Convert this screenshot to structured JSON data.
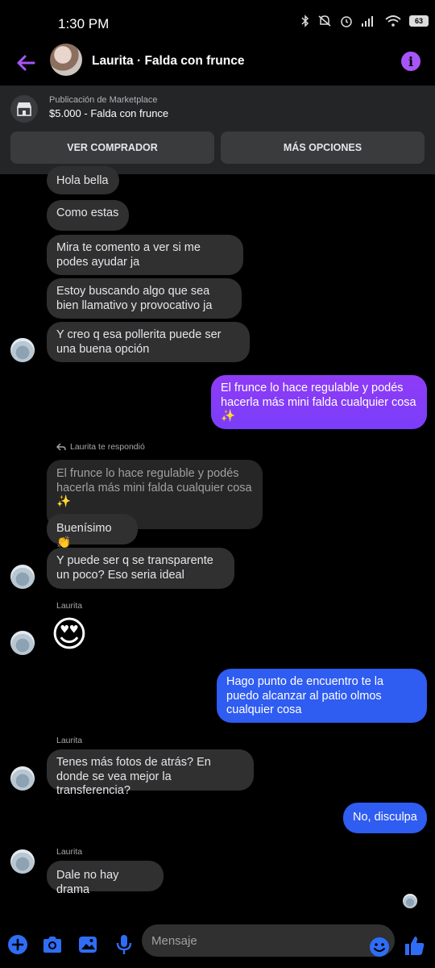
{
  "status_bar": {
    "time": "1:30 PM",
    "battery": "63"
  },
  "header": {
    "title": "Laurita · Falda con frunce"
  },
  "marketplace": {
    "label": "Publicación de Marketplace",
    "item": "$5.000 - Falda con frunce",
    "btn_buyer": "VER COMPRADOR",
    "btn_more": "MÁS OPCIONES"
  },
  "messages": {
    "m1": "Hola bella",
    "m2": "Como estas",
    "m3": "Mira te comento a ver si me podes ayudar ja",
    "m4": "Estoy buscando algo que sea bien llamativo y provocativo ja",
    "m5": "Y creo q esa pollerita puede ser una buena opción",
    "m6": "El frunce lo hace regulable y podés hacerla más mini falda cualquier cosa ✨",
    "reply_label": "Laurita te respondió",
    "quoted": "El frunce lo hace regulable y podés hacerla más mini falda cualquier cosa ✨",
    "m7": "Buenísimo 👏",
    "m8": "Y puede ser q se transparente un poco? Eso seria ideal",
    "name1": "Laurita",
    "m9": "😍",
    "m10": "Hago punto de encuentro te la puedo alcanzar al patio olmos cualquier cosa",
    "name2": "Laurita",
    "m11": "Tenes más fotos de atrás? En donde se vea mejor la transferencia?",
    "m12": "No, disculpa",
    "name3": "Laurita",
    "m13": "Dale no hay drama"
  },
  "composer": {
    "placeholder": "Mensaje"
  },
  "colors": {
    "accent": "#a855f7",
    "outgoing_blue": "#2f5cf1",
    "outgoing_purple": "#8f3cf5",
    "incoming": "#303030"
  },
  "icons": [
    "back-arrow-icon",
    "info-icon",
    "marketplace-store-icon",
    "plus-icon",
    "camera-icon",
    "gallery-icon",
    "microphone-icon",
    "emoji-icon",
    "thumbs-up-icon"
  ]
}
